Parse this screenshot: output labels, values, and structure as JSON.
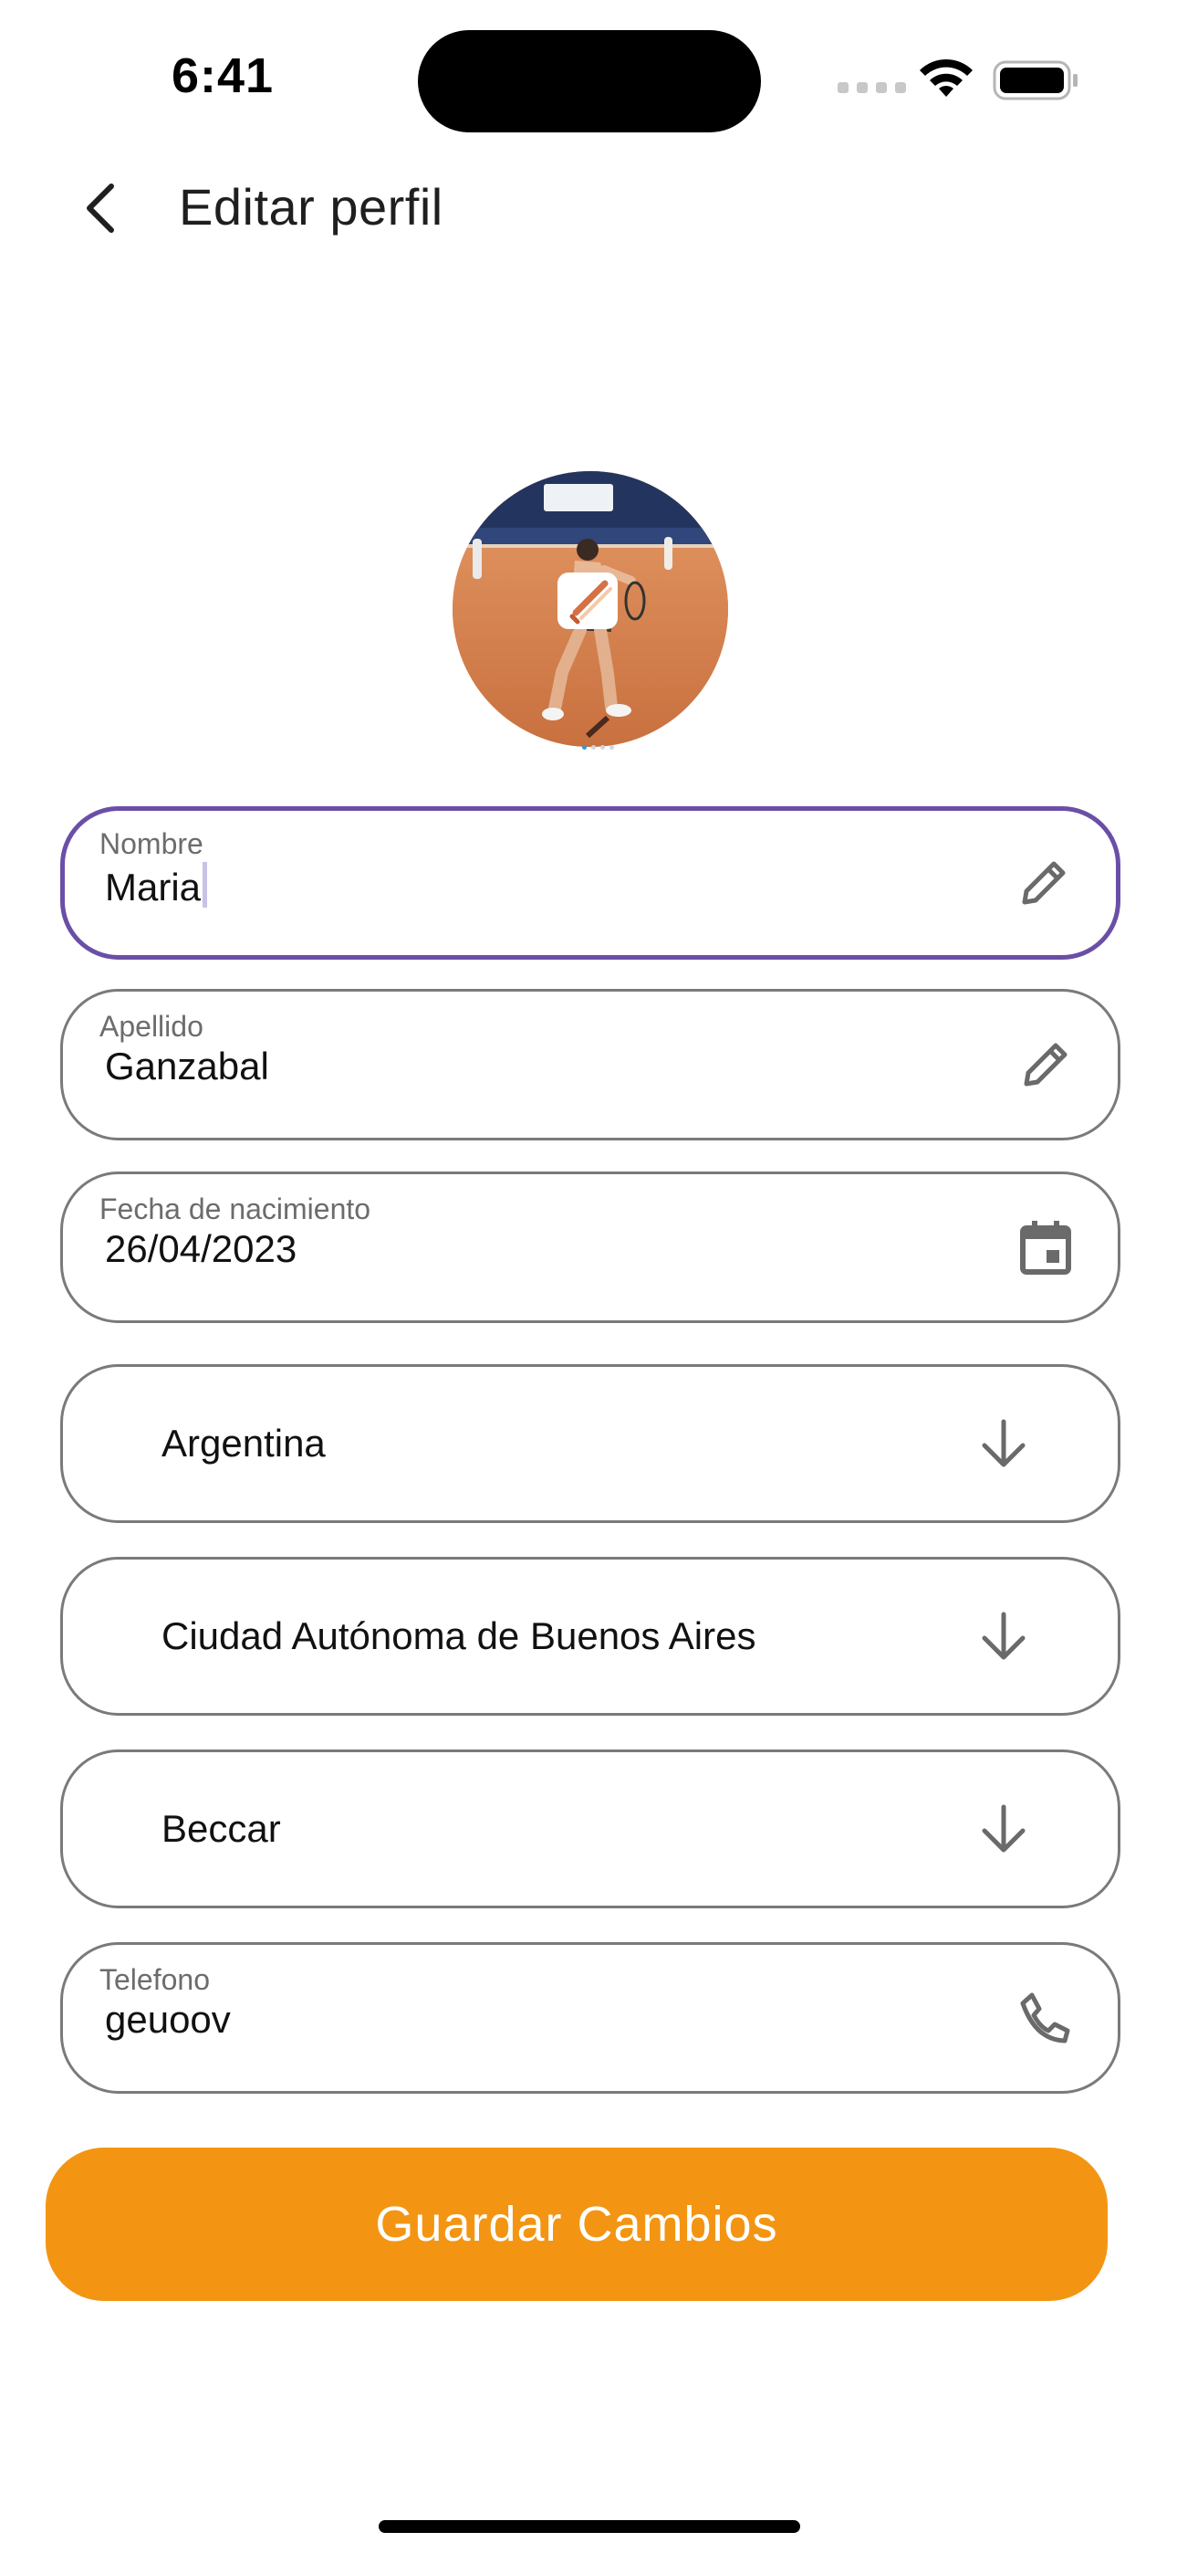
{
  "status_bar": {
    "time": "6:41"
  },
  "header": {
    "title": "Editar perfil"
  },
  "form": {
    "nombre": {
      "label": "Nombre",
      "value": "Maria"
    },
    "apellido": {
      "label": "Apellido",
      "value": "Ganzabal"
    },
    "fecha": {
      "label": "Fecha de nacimiento",
      "value": "26/04/2023"
    },
    "pais": {
      "value": "Argentina"
    },
    "provincia": {
      "value": "Ciudad Autónoma de Buenos Aires"
    },
    "localidad": {
      "value": "Beccar"
    },
    "telefono": {
      "label": "Telefono",
      "value": "geuoov"
    }
  },
  "actions": {
    "save_label": "Guardar Cambios"
  },
  "icons": {
    "back": "chevron-left-icon",
    "edit": "pencil-icon",
    "calendar": "calendar-icon",
    "dropdown": "arrow-down-icon",
    "phone": "phone-icon"
  },
  "colors": {
    "accent_focus": "#6a4fa6",
    "primary_button": "#f39512",
    "border": "#7a7a7a"
  }
}
